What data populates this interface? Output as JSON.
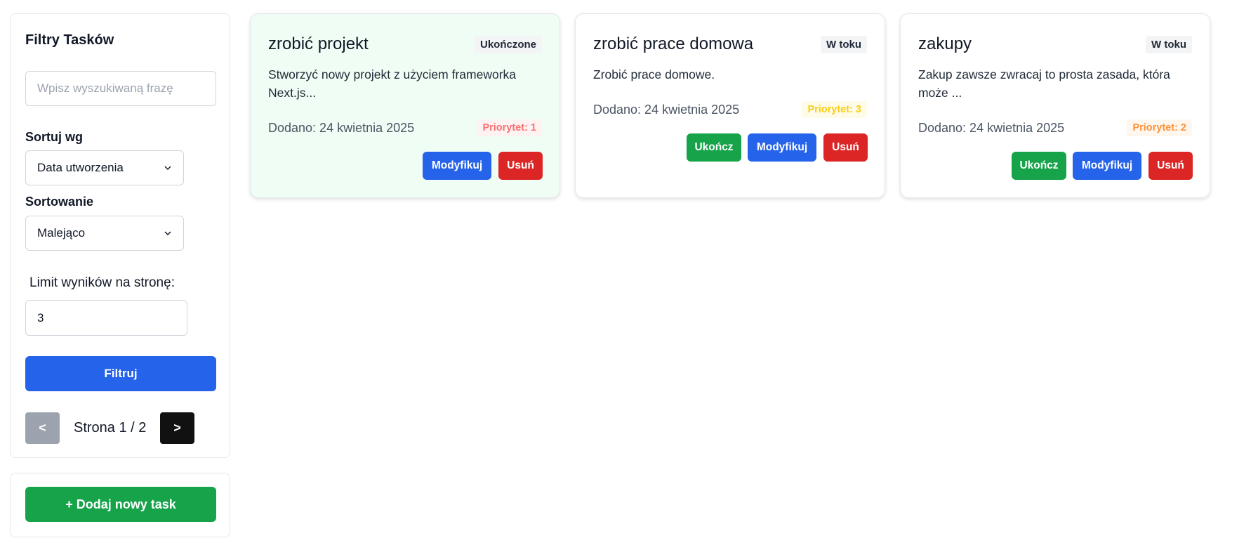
{
  "filters": {
    "title": "Filtry Tasków",
    "search_placeholder": "Wpisz wyszukiwaną frazę",
    "sort_by_label": "Sortuj wg",
    "sort_by_value": "Data utworzenia",
    "sort_order_label": "Sortowanie",
    "sort_order_value": "Malejąco",
    "limit_label": "Limit wyników na stronę:",
    "limit_value": "3",
    "filter_button": "Filtruj",
    "prev_button": "<",
    "next_button": ">",
    "page_info": "Strona 1 / 2"
  },
  "add_button": "+ Dodaj nowy task",
  "tasks": [
    {
      "title": "zrobić projekt",
      "status": "Ukończone",
      "description": "Stworzyć nowy projekt z użyciem frameworka Next.js...",
      "date": "Dodano: 24 kwietnia 2025",
      "priority": "Priorytet: 1",
      "priority_color": "#f87171",
      "card_color": "#f0fdf4",
      "modify_label": "Modyfikuj",
      "delete_label": "Usuń"
    },
    {
      "title": "zrobić prace domowa",
      "status": "W toku",
      "description": "Zrobić prace domowe.",
      "date": "Dodano: 24 kwietnia 2025",
      "priority": "Priorytet: 3",
      "priority_color": "#facc15",
      "card_color": "#ffffff",
      "complete_label": "Ukończ",
      "modify_label": "Modyfikuj",
      "delete_label": "Usuń"
    },
    {
      "title": "zakupy",
      "status": "W toku",
      "description": "Zakup zawsze zwracaj to prosta zasada, która może ...",
      "date": "Dodano: 24 kwietnia 2025",
      "priority": "Priorytet: 2",
      "priority_color": "#fb923c",
      "card_color": "#ffffff",
      "complete_label": "Ukończ",
      "modify_label": "Modyfikuj",
      "delete_label": "Usuń"
    }
  ],
  "colors": {
    "primary": "#2563eb",
    "success": "#16a34a",
    "danger": "#dc2626"
  }
}
